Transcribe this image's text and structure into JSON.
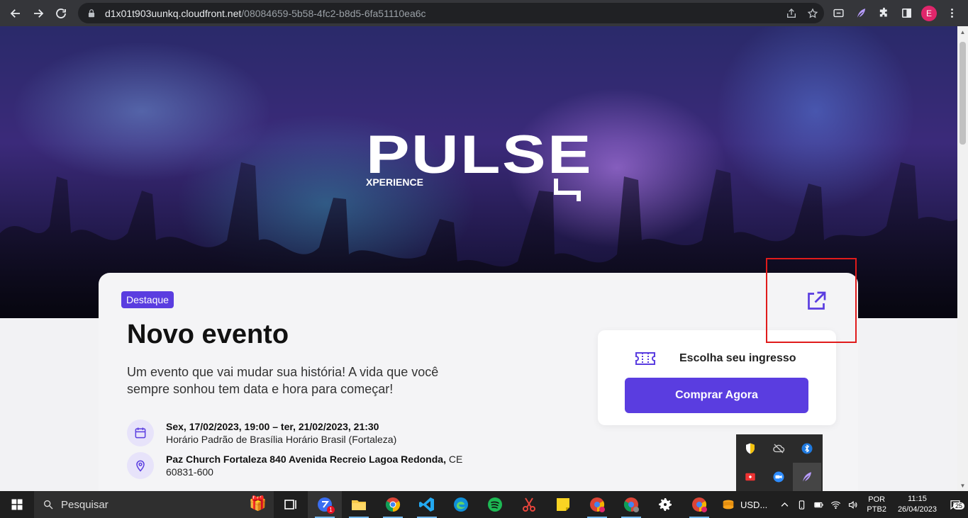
{
  "browser": {
    "url_host": "d1x01t903uunkq.cloudfront.net",
    "url_path": "/08084659-5b58-4fc2-b8d5-6fa51110ea6c",
    "profile_initial": "E"
  },
  "hero": {
    "logo_main": "PULSE",
    "logo_sub": "XPERIENCE"
  },
  "event": {
    "badge": "Destaque",
    "title": "Novo evento",
    "description": "Um evento que vai mudar sua história! A vida que você sempre sonhou tem data e hora para começar!",
    "date_bold": "Sex, 17/02/2023, 19:00 – ter, 21/02/2023, 21:30",
    "date_sub": "Horário Padrão de Brasília Horário Brasil (Fortaleza)",
    "location_bold": "Paz Church Fortaleza 840 Avenida Recreio Lagoa Redonda,",
    "location_rest": " CE",
    "location_zip": "60831-600"
  },
  "ticket": {
    "label": "Escolha seu ingresso",
    "buy_button": "Comprar Agora"
  },
  "taskbar": {
    "search_placeholder": "Pesquisar",
    "chat_badge": "1",
    "usd_label": "USD...",
    "lang_top": "POR",
    "lang_bottom": "PTB2",
    "time": "11:15",
    "date": "26/04/2023",
    "notification_count": "25"
  },
  "colors": {
    "accent": "#5a3de0",
    "highlight": "#e01b1b"
  }
}
